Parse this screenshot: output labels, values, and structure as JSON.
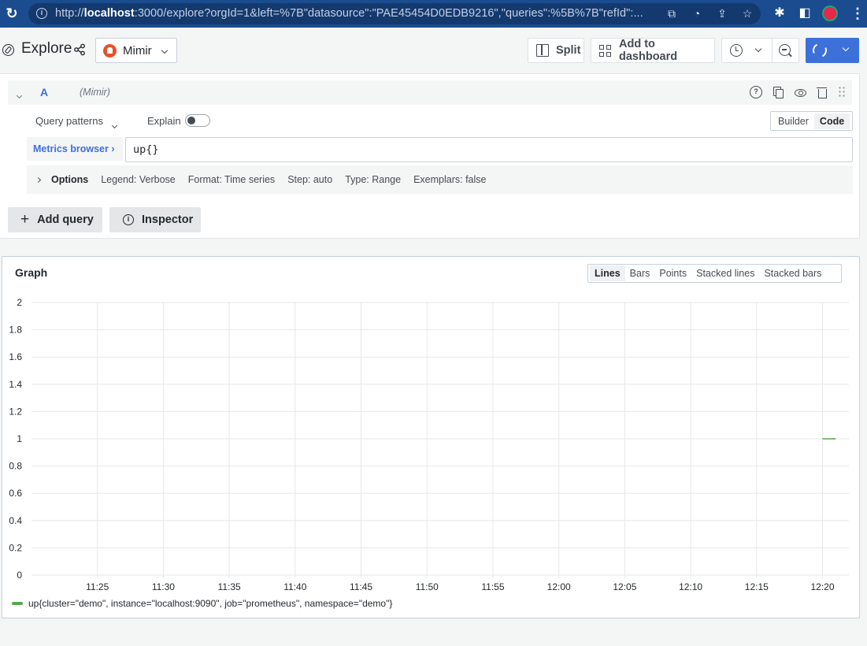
{
  "browser": {
    "url_prefix": "http://",
    "url_host": "localhost",
    "url_rest": ":3000/explore?orgId=1&left=%7B\"datasource\":\"PAE45454D0EDB9216\",\"queries\":%5B%7B\"refId\":..."
  },
  "toolbar": {
    "title": "Explore",
    "datasource": "Mimir",
    "split_label": "Split",
    "add_dashboard_label": "Add to dashboard",
    "run_color": "#3d71d9"
  },
  "query": {
    "ref_id": "A",
    "datasource_label": "(Mimir)",
    "patterns_label": "Query patterns",
    "explain_label": "Explain",
    "explain_enabled": false,
    "modes": [
      "Builder",
      "Code"
    ],
    "active_mode": "Code",
    "metrics_browser_label": "Metrics browser ›",
    "expression": "up{}",
    "options_title": "Options",
    "options": [
      "Legend: Verbose",
      "Format: Time series",
      "Step: auto",
      "Type: Range",
      "Exemplars: false"
    ],
    "add_query_label": "Add query",
    "inspector_label": "Inspector"
  },
  "graph": {
    "title": "Graph",
    "viz_types": [
      "Lines",
      "Bars",
      "Points",
      "Stacked lines",
      "Stacked bars"
    ],
    "active_viz": "Lines"
  },
  "chart_data": {
    "type": "line",
    "title": "Graph",
    "xlabel": "",
    "ylabel": "",
    "ylim": [
      0,
      2
    ],
    "y_ticks": [
      "0",
      "0.2",
      "0.4",
      "0.6",
      "0.8",
      "1",
      "1.2",
      "1.4",
      "1.6",
      "1.8",
      "2"
    ],
    "x_ticks": [
      "11:25",
      "11:30",
      "11:35",
      "11:40",
      "11:45",
      "11:50",
      "11:55",
      "12:00",
      "12:05",
      "12:10",
      "12:15",
      "12:20"
    ],
    "x_range_minutes": [
      "11:20",
      "12:22"
    ],
    "grid": true,
    "legend_position": "bottom-left",
    "series": [
      {
        "name": "up{cluster=\"demo\", instance=\"localhost:9090\", job=\"prometheus\", namespace=\"demo\"}",
        "color": "#56a64b",
        "x": [
          "12:20",
          "12:21"
        ],
        "values": [
          1,
          1
        ]
      }
    ]
  }
}
